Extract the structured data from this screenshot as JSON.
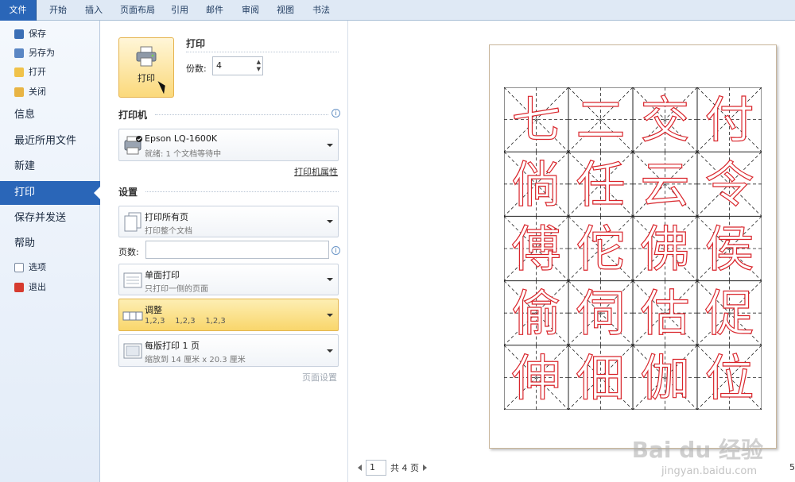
{
  "ribbon": {
    "tabs": [
      "文件",
      "开始",
      "插入",
      "页面布局",
      "引用",
      "邮件",
      "审阅",
      "视图",
      "书法"
    ]
  },
  "sidebar": {
    "small_top": [
      {
        "label": "保存",
        "icon": "save-icon"
      },
      {
        "label": "另存为",
        "icon": "save-as-icon"
      },
      {
        "label": "打开",
        "icon": "open-folder-icon"
      },
      {
        "label": "关闭",
        "icon": "close-folder-icon"
      }
    ],
    "big": [
      "信息",
      "最近所用文件",
      "新建",
      "打印",
      "保存并发送",
      "帮助"
    ],
    "active": "打印",
    "small_bottom": [
      {
        "label": "选项",
        "icon": "options-icon"
      },
      {
        "label": "退出",
        "icon": "exit-icon"
      }
    ]
  },
  "print": {
    "button_label": "打印",
    "section_title": "打印",
    "copies_label": "份数:",
    "copies_value": "4"
  },
  "printer": {
    "section_title": "打印机",
    "name": "Epson LQ-1600K",
    "status": "就绪: 1 个文档等待中",
    "properties_link": "打印机属性"
  },
  "settings": {
    "section_title": "设置",
    "range": {
      "main": "打印所有页",
      "sub": "打印整个文档"
    },
    "pages_label": "页数:",
    "pages_value": "",
    "sides": {
      "main": "单面打印",
      "sub": "只打印一侧的页面"
    },
    "collate": {
      "main": "调整",
      "sub": "1,2,3    1,2,3    1,2,3"
    },
    "per_sheet": {
      "main": "每版打印 1 页",
      "sub": "缩放到 14 厘米 x 20.3 厘米"
    },
    "page_setup_link": "页面设置"
  },
  "preview": {
    "page_current": "1",
    "page_total": "共 4 页",
    "zoom_partial": "5",
    "watermark": "Bai du 经验",
    "watermark_sub": "jingyan.baidu.com",
    "characters": [
      [
        "七",
        "二",
        "交",
        "付"
      ],
      [
        "倘",
        "任",
        "云",
        "令"
      ],
      [
        "傅",
        "佗",
        "佛",
        "侯"
      ],
      [
        "偷",
        "伺",
        "估",
        "促"
      ],
      [
        "伸",
        "佃",
        "伽",
        "位"
      ]
    ],
    "char_color": "#d9262c"
  },
  "colors": {
    "accent": "#2a66b8",
    "highlight": "#f9d66b"
  }
}
